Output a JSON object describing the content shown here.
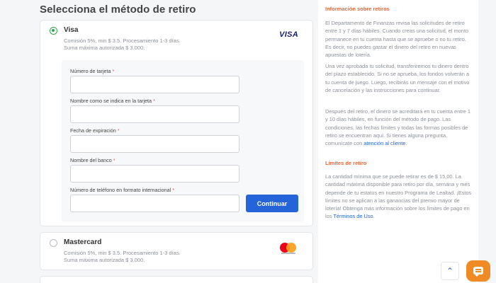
{
  "page_title": "Selecciona el método de retiro",
  "methods": [
    {
      "name": "Visa",
      "logo_text": "VISA",
      "selected": true,
      "desc_line1": "Comisión 5%, min $ 3.5. Procesamiento 1-3 días.",
      "desc_line2": "Suma máxima autorizada $ 3.000."
    },
    {
      "name": "Mastercard",
      "logo": "mastercard-icon",
      "selected": false,
      "desc_line1": "Comisión 5%, min $ 3.5. Procesamiento 1-3 días.",
      "desc_line2": "Suma máxima autorizada $ 3.000."
    }
  ],
  "form": {
    "fields": [
      {
        "label": "Número de tarjeta",
        "required_mark": "*",
        "value": ""
      },
      {
        "label": "Nombre como se indica en la tarjeta",
        "required_mark": "*",
        "value": ""
      },
      {
        "label": "Fecha de expiración",
        "required_mark": "*",
        "value": ""
      },
      {
        "label": "Nombre del banco",
        "required_mark": "*",
        "value": ""
      },
      {
        "label": "Número de teléfono en formato internacional",
        "required_mark": "*",
        "value": ""
      }
    ],
    "submit_label": "Continuar"
  },
  "sidebar": {
    "info_title": "Información sobre retiros",
    "info_para1": "El Departamento de Finanzas revisa las solicitudes de retiro entre 1 y 7 días hábiles. Cuando creas una solicitud, el monto permanece en tu cuenta hasta que se apruebe o no tu retiro. Es decir, no puedes gastar el dinero del retiro en nuevas apuestas de lotería.",
    "info_para2": "Una vez aprobada tu solicitud, transferiremos tu dinero dentro del plazo establecido. Si no se aprueba, los fondos volverán a tu cuenta de juego. Luego, recibirás un mensaje con el motivo de cancelación y las instrucciones para continuar.",
    "info_para3_text": "Después del retiro, el dinero se acreditará en tu cuenta entre 1 y 10 días hábiles, en función del método de pago. Las condiciones, las fechas límites y todas las formas posibles de retiro se encuentran aquí. Si tienes alguna pregunta, comunícate con ",
    "info_para3_link": "atención al cliente",
    "info_para3_end": ".",
    "limits_title": "Límites de retiro",
    "limits_para_text": "La cantidad mínima que se puede retirar es de $ 15,00. La cantidad máxima disponible para retiro por día, semana y mes depende de tu estatus en nuestro Programa de Lealtad. ¡Estos límites no se aplican a las ganancias del premio mayor de lotería! Obtenga más información sobre los límites de pago en los ",
    "limits_para_link": "Términos de Uso",
    "limits_para_end": "."
  },
  "floating": {
    "scroll_top_icon": "chevron-up-icon",
    "scroll_top_glyph": "⌃",
    "chat_icon": "chat-icon"
  },
  "colors": {
    "accent_blue": "#2563d9",
    "selected_green": "#2da94f",
    "section_orange": "#e2673a",
    "chat_orange": "#f08a24"
  }
}
